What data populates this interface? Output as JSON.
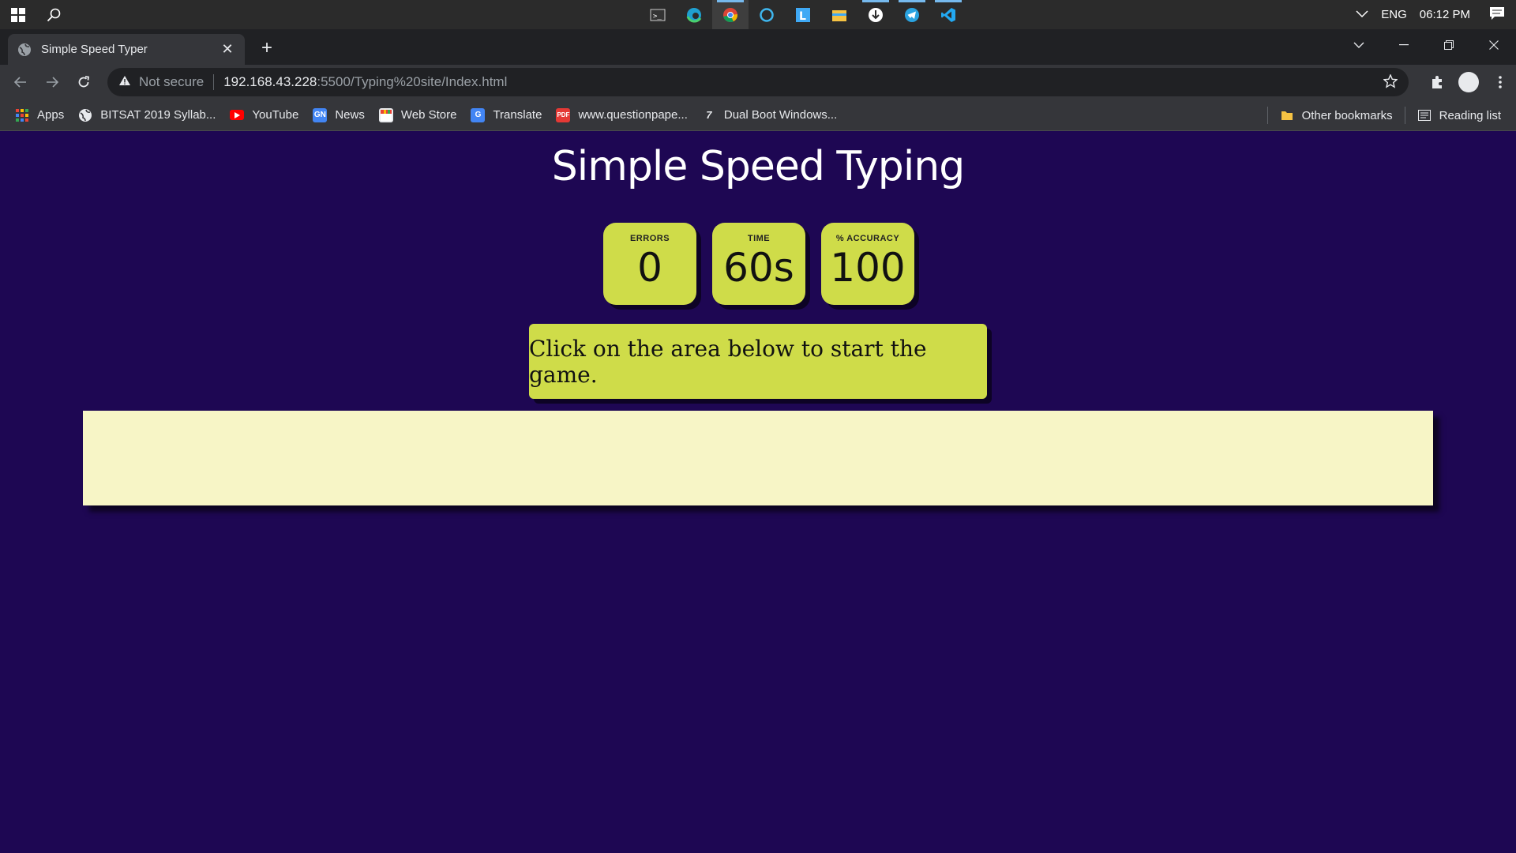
{
  "taskbar": {
    "apps": [
      "terminal-icon",
      "edge-icon",
      "chrome-icon",
      "cortana-icon",
      "word-app-icon",
      "file-explorer-icon",
      "downloader-icon",
      "telegram-icon",
      "vscode-icon"
    ],
    "language": "ENG",
    "clock": "06:12 PM"
  },
  "browser": {
    "tab_title": "Simple Speed Typer",
    "security_label": "Not secure",
    "url_host": "192.168.43.228",
    "url_path": ":5500/Typing%20site/Index.html"
  },
  "bookmarks": {
    "items": [
      {
        "label": "Apps",
        "icon": "apps-grid-icon"
      },
      {
        "label": "BITSAT 2019 Syllab...",
        "icon": "globe-icon"
      },
      {
        "label": "YouTube",
        "icon": "youtube-icon"
      },
      {
        "label": "News",
        "icon": "news-icon"
      },
      {
        "label": "Web Store",
        "icon": "webstore-icon"
      },
      {
        "label": "Translate",
        "icon": "translate-icon"
      },
      {
        "label": "www.questionpape...",
        "icon": "pdf-icon"
      },
      {
        "label": "Dual Boot Windows...",
        "icon": "site-icon"
      }
    ],
    "other": "Other bookmarks",
    "reading_list": "Reading list"
  },
  "page": {
    "heading": "Simple Speed Typing",
    "stats": {
      "errors_label": "ERRORS",
      "errors_value": "0",
      "time_label": "TIME",
      "time_value": "60s",
      "accuracy_label": "% ACCURACY",
      "accuracy_value": "100"
    },
    "quote": "Click on the area below to start the game."
  },
  "colors": {
    "page_bg": "#1e0753",
    "card": "#cfdc49",
    "input_bg": "#f7f5c6"
  }
}
